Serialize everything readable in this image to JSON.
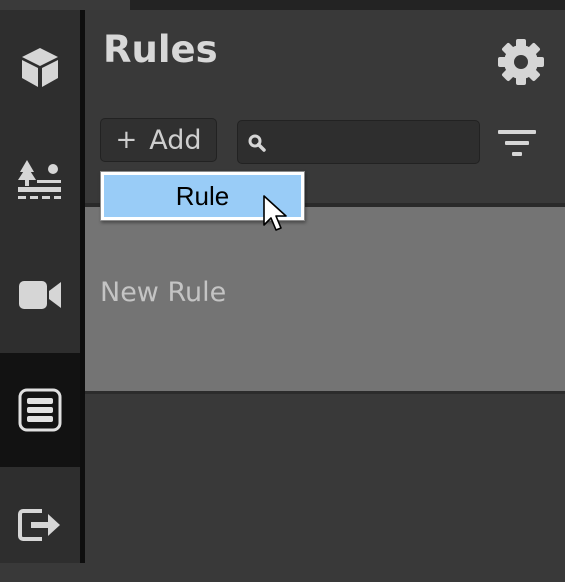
{
  "app": {
    "page_title": "Rules"
  },
  "sidebar": {
    "items": [
      {
        "icon": "cube-icon",
        "active": false
      },
      {
        "icon": "tree-landscape-icon",
        "active": false
      },
      {
        "icon": "video-camera-icon",
        "active": false
      },
      {
        "icon": "list-icon",
        "active": true
      },
      {
        "icon": "exit-icon",
        "active": false
      }
    ]
  },
  "toolbar": {
    "add_plus": "+",
    "add_label": "Add",
    "search": {
      "value": "",
      "placeholder": ""
    },
    "settings_icon": "gear-icon",
    "filter_icon": "filter-icon"
  },
  "dropdown": {
    "items": [
      {
        "label": "Rule"
      }
    ]
  },
  "rules_list": [
    {
      "name": "New Rule"
    }
  ],
  "colors": {
    "background": "#393939",
    "sidebar": "#2e2e2e",
    "sidebar_active": "#121212",
    "list_item": "#747474",
    "dropdown_highlight": "#99ccf7"
  }
}
